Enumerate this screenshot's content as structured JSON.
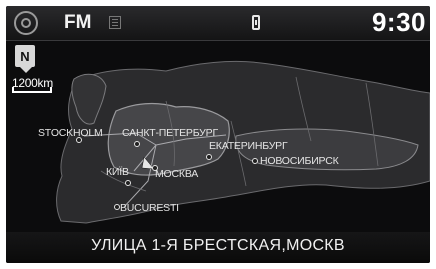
{
  "status_bar": {
    "source": "FM",
    "time": "9:30",
    "icons": [
      "home-icon",
      "radio-signal-icon",
      "phone-icon"
    ]
  },
  "map": {
    "scale_label": "1200km",
    "north_label": "N",
    "cities": [
      {
        "name": "STOCKHOLM"
      },
      {
        "name": "САНКТ-ПЕТЕРБУРГ"
      },
      {
        "name": "ЕКАТЕРИНБУРГ"
      },
      {
        "name": "НОВОСИБИРСК"
      },
      {
        "name": "КИЇВ"
      },
      {
        "name": "МОСКВА"
      },
      {
        "name": "BUCURESTI"
      }
    ]
  },
  "street_bar": {
    "current_street": "УЛИЦА 1-Я БРЕСТСКАЯ,МОСКВ"
  },
  "colors": {
    "background": "#0c0c0d",
    "text": "#f0f0f0",
    "land": "#2e2e30",
    "highlight_region": "#4a4a4e"
  }
}
